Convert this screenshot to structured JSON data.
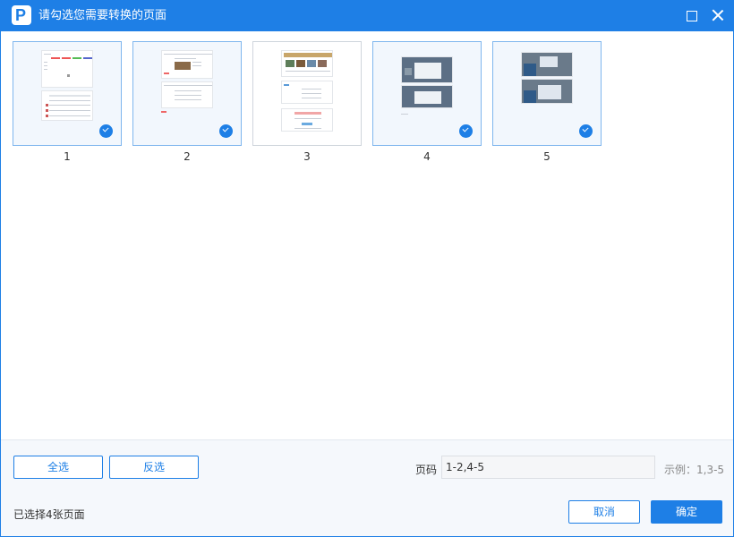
{
  "window": {
    "title": "请勾选您需要转换的页面"
  },
  "pages": [
    {
      "label": "1",
      "selected": true
    },
    {
      "label": "2",
      "selected": true
    },
    {
      "label": "3",
      "selected": false
    },
    {
      "label": "4",
      "selected": true
    },
    {
      "label": "5",
      "selected": true
    }
  ],
  "footer": {
    "select_all": "全选",
    "invert": "反选",
    "range_label": "页码",
    "range_value": "1-2,4-5",
    "hint": "示例：1,3-5",
    "status": "已选择4张页面",
    "cancel": "取消",
    "confirm": "确定"
  },
  "colors": {
    "accent": "#1e7fe6",
    "footer_bg": "#f5f8fc"
  }
}
